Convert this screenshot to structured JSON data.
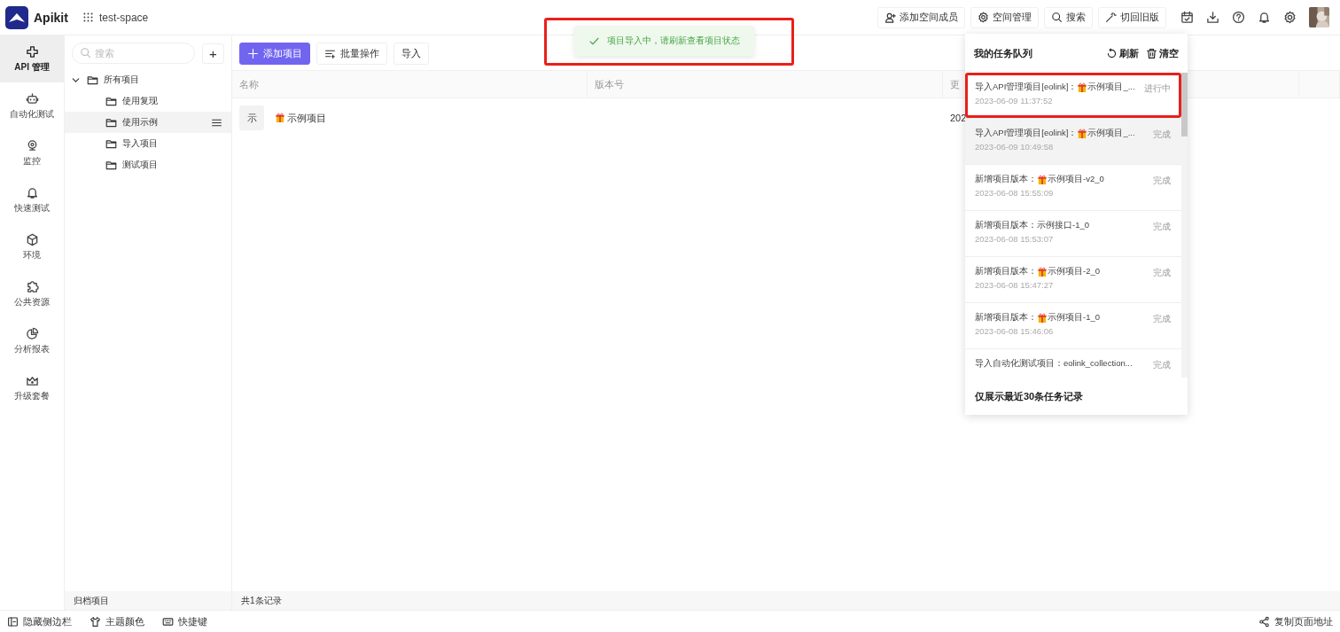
{
  "app": {
    "name": "Apikit",
    "space": "test-space"
  },
  "header_buttons": [
    {
      "kind": "user-add",
      "label": "添加空间成员"
    },
    {
      "kind": "gear",
      "label": "空间管理"
    },
    {
      "kind": "search",
      "label": "搜索"
    },
    {
      "kind": "wand",
      "label": "切回旧版"
    }
  ],
  "header_icons": [
    {
      "kind": "calendar"
    },
    {
      "kind": "download"
    },
    {
      "kind": "help"
    },
    {
      "kind": "bell"
    },
    {
      "kind": "settings"
    },
    {
      "kind": "avatar"
    }
  ],
  "nav": [
    {
      "kind": "api",
      "label": "API 管理",
      "selected": true
    },
    {
      "kind": "robot",
      "label": "自动化测试",
      "selected": false
    },
    {
      "kind": "camera",
      "label": "监控",
      "selected": false
    },
    {
      "kind": "bell",
      "label": "快速测试",
      "selected": false
    },
    {
      "kind": "cube",
      "label": "环境",
      "selected": false
    },
    {
      "kind": "puzzle",
      "label": "公共资源",
      "selected": false
    },
    {
      "kind": "pie",
      "label": "分析报表",
      "selected": false
    },
    {
      "kind": "crown",
      "label": "升级套餐",
      "selected": false
    }
  ],
  "tree": {
    "search_placeholder": "搜索",
    "add_label": "+",
    "root": {
      "label": "所有项目",
      "expanded": true,
      "children": [
        {
          "label": "使用复现",
          "selected": false
        },
        {
          "label": "使用示例",
          "selected": true
        },
        {
          "label": "导入项目",
          "selected": false
        },
        {
          "label": "测试项目",
          "selected": false
        }
      ]
    },
    "footer": "归档项目"
  },
  "toolbar": [
    {
      "kind": "primary",
      "label": "添加项目"
    },
    {
      "kind": "batch",
      "label": "批量操作"
    },
    {
      "kind": "plain",
      "label": "导入"
    }
  ],
  "table": {
    "columns": [
      "名称",
      "版本号",
      "更"
    ],
    "rows": [
      {
        "avatar": "示",
        "name": "示例项目",
        "gift": true,
        "column_2": "",
        "column_3": "202"
      }
    ],
    "footer": "共1条记录"
  },
  "toast": {
    "text": "项目导入中，请刷新查看项目状态",
    "highlighted": true
  },
  "task_panel": {
    "title": "我的任务队列",
    "actions": [
      {
        "kind": "refresh",
        "label": "刷新"
      },
      {
        "kind": "trash",
        "label": "清空"
      }
    ],
    "items": [
      {
        "prefix": "导入API管理项目[eolink]：",
        "gift": true,
        "name": "示例项目_...",
        "time": "2023-06-09 11:37:52",
        "status": "进行中",
        "selected": false,
        "highlighted": true
      },
      {
        "prefix": "导入API管理项目[eolink]：",
        "gift": true,
        "name": "示例项目_...",
        "time": "2023-06-09 10:49:58",
        "status": "完成",
        "selected": true,
        "highlighted": false
      },
      {
        "prefix": "新增项目版本：",
        "gift": true,
        "name": "示例项目-v2_0",
        "time": "2023-06-08 15:55:09",
        "status": "完成",
        "selected": false,
        "highlighted": false
      },
      {
        "prefix": "新增项目版本：",
        "gift": false,
        "name": "示例接口-1_0",
        "time": "2023-06-08 15:53:07",
        "status": "完成",
        "selected": false,
        "highlighted": false
      },
      {
        "prefix": "新增项目版本：",
        "gift": true,
        "name": "示例项目-2_0",
        "time": "2023-06-08 15:47:27",
        "status": "完成",
        "selected": false,
        "highlighted": false
      },
      {
        "prefix": "新增项目版本：",
        "gift": true,
        "name": "示例项目-1_0",
        "time": "2023-06-08 15:46:06",
        "status": "完成",
        "selected": false,
        "highlighted": false
      },
      {
        "prefix": "导入自动化测试项目：",
        "gift": false,
        "name": "eolink_collection...",
        "status": "完成",
        "selected": false,
        "highlighted": false
      }
    ],
    "footer": "仅展示最近30条任务记录"
  },
  "status_bar": {
    "left": [
      {
        "kind": "sidebar",
        "label": "隐藏侧边栏"
      },
      {
        "kind": "shirt",
        "label": "主题颜色"
      },
      {
        "kind": "keyboard",
        "label": "快捷键"
      }
    ],
    "right": [
      {
        "kind": "share",
        "label": "复制页面地址"
      }
    ]
  }
}
